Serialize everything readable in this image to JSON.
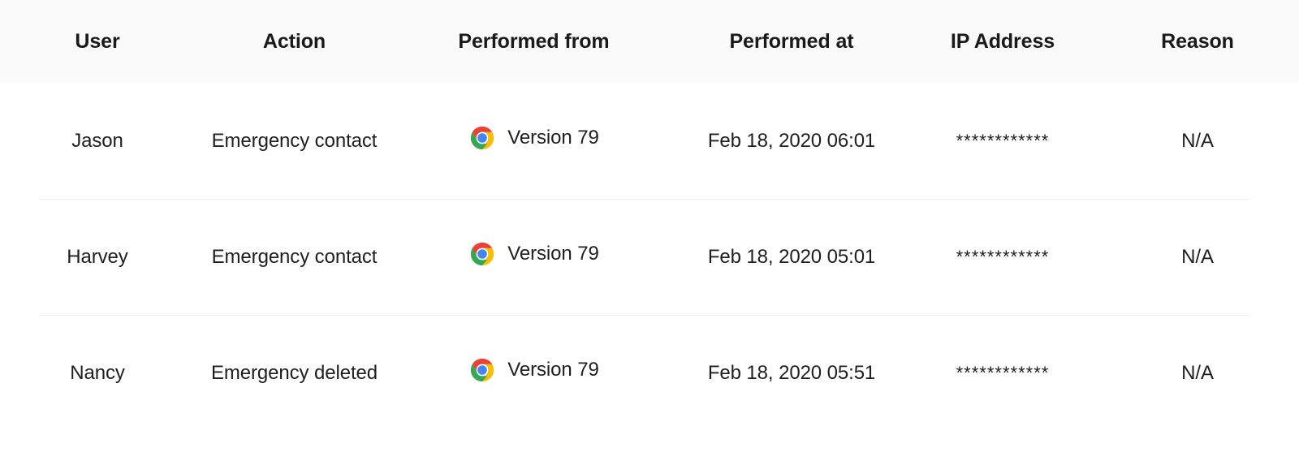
{
  "table": {
    "columns": [
      {
        "key": "user",
        "label": "User"
      },
      {
        "key": "action",
        "label": "Action"
      },
      {
        "key": "performed_from",
        "label": "Performed from"
      },
      {
        "key": "performed_at",
        "label": "Performed at"
      },
      {
        "key": "ip_address",
        "label": "IP Address"
      },
      {
        "key": "reason",
        "label": "Reason"
      }
    ],
    "rows": [
      {
        "user": "Jason",
        "action": "Emergency contact",
        "browser_icon": "chrome-icon",
        "browser_version": "Version 79",
        "performed_at": "Feb 18, 2020 06:01",
        "ip_address": "************",
        "reason": "N/A"
      },
      {
        "user": "Harvey",
        "action": "Emergency contact",
        "browser_icon": "chrome-icon",
        "browser_version": "Version 79",
        "performed_at": "Feb 18, 2020 05:01",
        "ip_address": "************",
        "reason": "N/A"
      },
      {
        "user": "Nancy",
        "action": "Emergency deleted",
        "browser_icon": "chrome-icon",
        "browser_version": "Version 79",
        "performed_at": "Feb 18, 2020 05:51",
        "ip_address": "************",
        "reason": "N/A"
      }
    ]
  },
  "colors": {
    "header_background": "#fafafa",
    "header_text": "#1a1a1a",
    "body_text": "#1f1f1f",
    "row_divider": "#efeff1",
    "page_background": "#ffffff",
    "chrome_red": "#ea4335",
    "chrome_yellow": "#fbbc05",
    "chrome_green": "#34a853",
    "chrome_blue": "#4285f4",
    "chrome_blue_ring": "#ffffff"
  }
}
